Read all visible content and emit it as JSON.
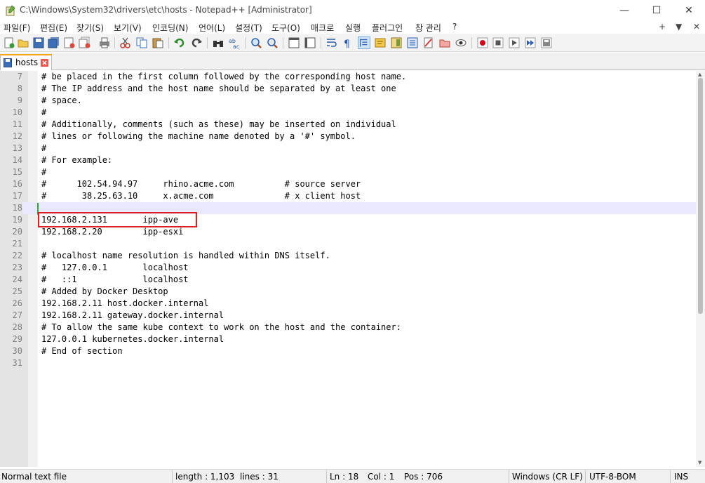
{
  "window": {
    "title": "C:\\Windows\\System32\\drivers\\etc\\hosts - Notepad++ [Administrator]",
    "min": "—",
    "max": "☐",
    "close": "✕"
  },
  "menu": {
    "items": [
      "파일(F)",
      "편집(E)",
      "찾기(S)",
      "보기(V)",
      "인코딩(N)",
      "언어(L)",
      "설정(T)",
      "도구(O)",
      "매크로",
      "실행",
      "플러그인",
      "창 관리",
      "?"
    ],
    "right": [
      "+",
      "▼",
      "✕"
    ]
  },
  "toolbar": {
    "icons": [
      "new-file-icon",
      "open-file-icon",
      "save-icon",
      "save-all-icon",
      "close-icon",
      "close-all-icon",
      "print-icon",
      "cut-icon",
      "copy-icon",
      "paste-icon",
      "undo-icon",
      "redo-icon",
      "find-icon",
      "replace-icon",
      "zoom-in-icon",
      "zoom-out-icon",
      "sync-vertical-icon",
      "sync-horizontal-icon",
      "word-wrap-icon",
      "show-all-chars-icon",
      "indent-guide-icon",
      "user-lang-icon",
      "doc-map-icon",
      "function-list-icon",
      "folder-workspace-icon",
      "doc-switcher-icon",
      "monitoring-icon",
      "record-macro-icon",
      "stop-macro-icon",
      "play-macro-icon",
      "run-macro-multiple-icon",
      "save-macro-icon"
    ]
  },
  "tab": {
    "label": "hosts"
  },
  "editor": {
    "lines": [
      {
        "num": "7",
        "text": "# be placed in the first column followed by the corresponding host name."
      },
      {
        "num": "8",
        "text": "# The IP address and the host name should be separated by at least one"
      },
      {
        "num": "9",
        "text": "# space."
      },
      {
        "num": "10",
        "text": "#"
      },
      {
        "num": "11",
        "text": "# Additionally, comments (such as these) may be inserted on individual"
      },
      {
        "num": "12",
        "text": "# lines or following the machine name denoted by a '#' symbol."
      },
      {
        "num": "13",
        "text": "#"
      },
      {
        "num": "14",
        "text": "# For example:"
      },
      {
        "num": "15",
        "text": "#"
      },
      {
        "num": "16",
        "text": "#      102.54.94.97     rhino.acme.com          # source server"
      },
      {
        "num": "17",
        "text": "#       38.25.63.10     x.acme.com              # x client host"
      },
      {
        "num": "18",
        "text": ""
      },
      {
        "num": "19",
        "text": "192.168.2.131       ipp-ave"
      },
      {
        "num": "20",
        "text": "192.168.2.20        ipp-esxi"
      },
      {
        "num": "21",
        "text": ""
      },
      {
        "num": "22",
        "text": "# localhost name resolution is handled within DNS itself."
      },
      {
        "num": "23",
        "text": "#   127.0.0.1       localhost"
      },
      {
        "num": "24",
        "text": "#   ::1             localhost"
      },
      {
        "num": "25",
        "text": "# Added by Docker Desktop"
      },
      {
        "num": "26",
        "text": "192.168.2.11 host.docker.internal"
      },
      {
        "num": "27",
        "text": "192.168.2.11 gateway.docker.internal"
      },
      {
        "num": "28",
        "text": "# To allow the same kube context to work on the host and the container:"
      },
      {
        "num": "29",
        "text": "127.0.0.1 kubernetes.docker.internal"
      },
      {
        "num": "30",
        "text": "# End of section"
      },
      {
        "num": "31",
        "text": ""
      }
    ],
    "current_line": "18",
    "highlighted_line": "19"
  },
  "status": {
    "filetype": "Normal text file",
    "length": "length : 1,103",
    "lines": "lines : 31",
    "ln": "Ln : 18",
    "col": "Col : 1",
    "pos": "Pos : 706",
    "eol": "Windows (CR LF)",
    "encoding": "UTF-8-BOM",
    "mode": "INS"
  },
  "colors": {
    "tab_accent": "#f7a41d",
    "current_line_bg": "#e8e8ff",
    "highlight_box": "#e02020",
    "change_marker": "#2fa82f"
  }
}
